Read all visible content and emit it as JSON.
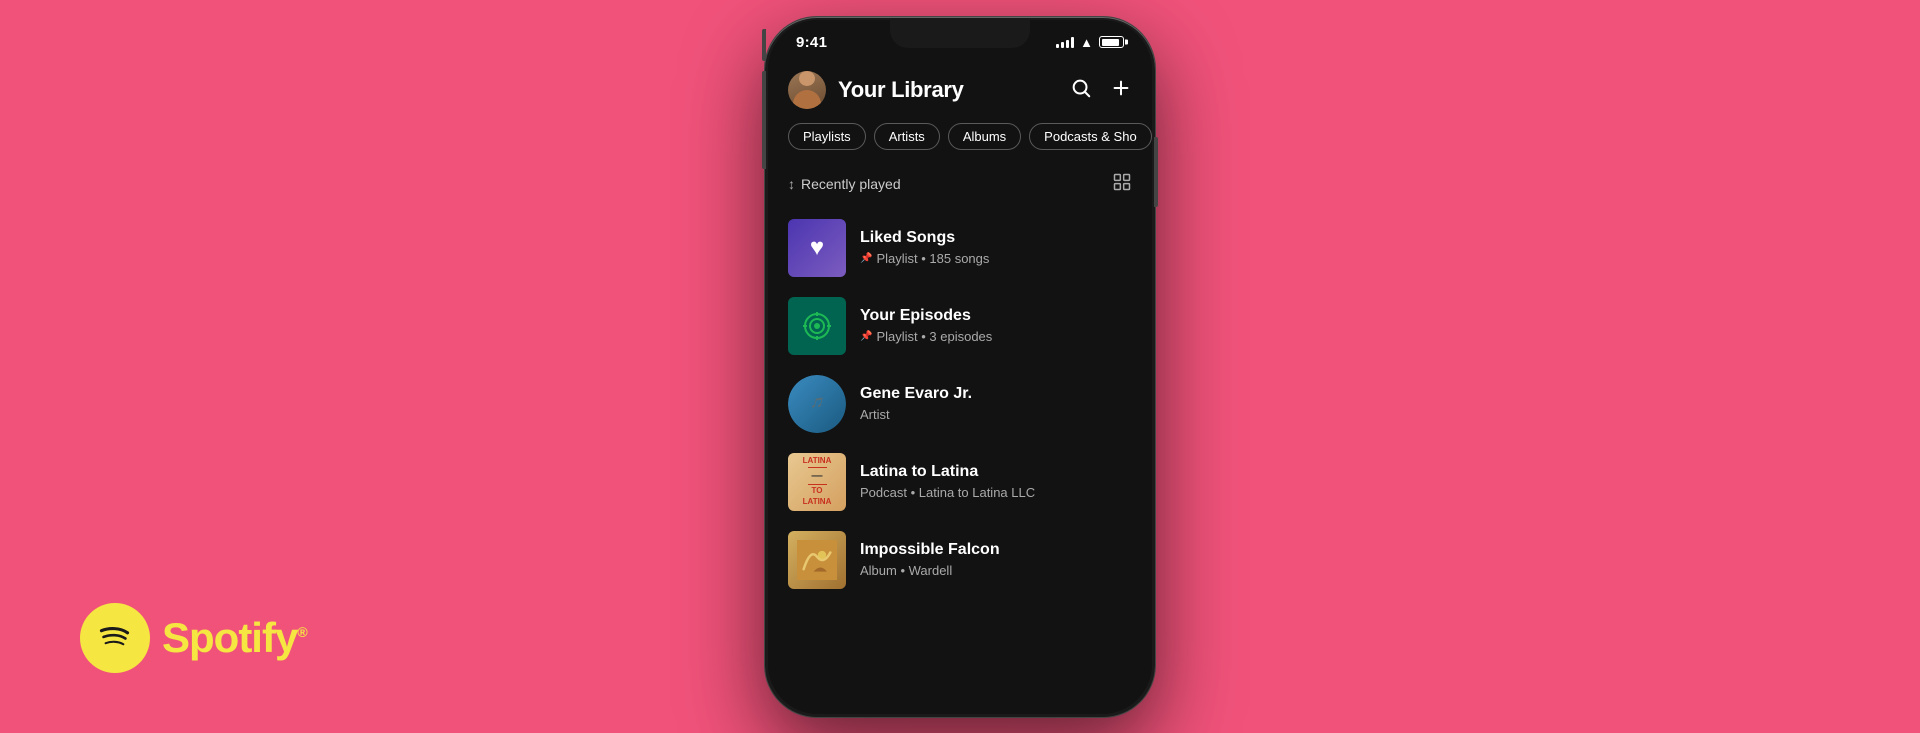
{
  "background_color": "#f0527a",
  "spotify_logo": {
    "text": "Spotify",
    "reg": "®"
  },
  "phone": {
    "status_bar": {
      "time": "9:41",
      "signal_bars": 4,
      "wifi": true,
      "battery": 85
    },
    "header": {
      "title": "Your Library",
      "search_label": "search",
      "add_label": "add"
    },
    "filter_chips": [
      {
        "label": "Playlists",
        "active": false
      },
      {
        "label": "Artists",
        "active": false
      },
      {
        "label": "Albums",
        "active": false
      },
      {
        "label": "Podcasts & Sho",
        "active": false
      }
    ],
    "sort": {
      "label": "Recently played",
      "grid_icon": "grid"
    },
    "library_items": [
      {
        "id": "liked-songs",
        "title": "Liked Songs",
        "subtitle": "Playlist • 185 songs",
        "pinned": true,
        "art_type": "liked-songs"
      },
      {
        "id": "your-episodes",
        "title": "Your Episodes",
        "subtitle": "Playlist • 3 episodes",
        "pinned": true,
        "art_type": "episodes"
      },
      {
        "id": "gene-evaro",
        "title": "Gene Evaro Jr.",
        "subtitle": "Artist",
        "pinned": false,
        "art_type": "artist"
      },
      {
        "id": "latina-to-latina",
        "title": "Latina to Latina",
        "subtitle": "Podcast • Latina to Latina LLC",
        "pinned": false,
        "art_type": "podcast"
      },
      {
        "id": "impossible-falcon",
        "title": "Impossible Falcon",
        "subtitle": "Album • Wardell",
        "pinned": false,
        "art_type": "album"
      }
    ]
  }
}
